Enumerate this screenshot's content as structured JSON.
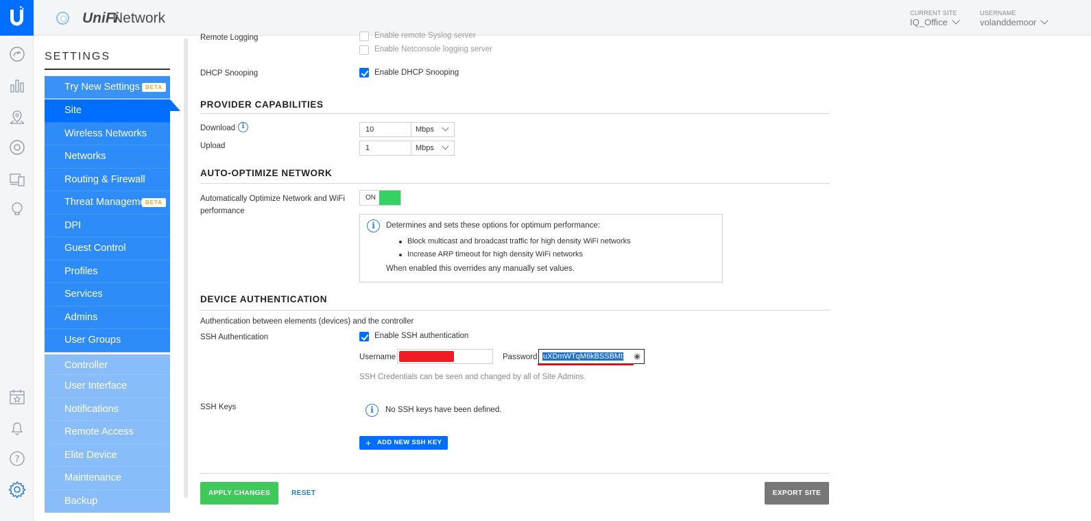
{
  "app": {
    "brand_unifi": "UniFi",
    "brand_network": "Network"
  },
  "topbar": {
    "site_label": "CURRENT SITE",
    "site_value": "IQ_Office",
    "user_label": "USERNAME",
    "user_value": "volanddemoor"
  },
  "leftnav": {
    "icons": [
      "dashboard-icon",
      "statistics-icon",
      "map-icon",
      "devices-icon",
      "clients-icon",
      "insights-icon",
      "events-icon",
      "alerts-icon",
      "help-icon",
      "settings-icon"
    ],
    "active_color": "#006fff"
  },
  "sidebar": {
    "title": "SETTINGS",
    "items": [
      {
        "label": "Try New Settings",
        "badge": "BETA"
      },
      {
        "label": "Site"
      },
      {
        "label": "Wireless Networks"
      },
      {
        "label": "Networks"
      },
      {
        "label": "Routing & Firewall"
      },
      {
        "label": "Threat Management",
        "badge": "BETA"
      },
      {
        "label": "DPI"
      },
      {
        "label": "Guest Control"
      },
      {
        "label": "Profiles"
      },
      {
        "label": "Services"
      },
      {
        "label": "Admins"
      },
      {
        "label": "User Groups"
      },
      {
        "label": "Controller"
      },
      {
        "label": "User Interface"
      },
      {
        "label": "Notifications"
      },
      {
        "label": "Remote Access"
      },
      {
        "label": "Elite Device"
      },
      {
        "label": "Maintenance"
      },
      {
        "label": "Backup"
      }
    ]
  },
  "remote_logging": {
    "label": "Remote Logging",
    "opt1": "Enable remote Syslog server",
    "opt2": "Enable Netconsole logging server"
  },
  "dhcp": {
    "label": "DHCP Snooping",
    "opt": "Enable DHCP Snooping",
    "checked": true
  },
  "provider": {
    "heading": "PROVIDER CAPABILITIES",
    "download_label": "Download",
    "download_value": "10",
    "download_unit": "Mbps",
    "upload_label": "Upload",
    "upload_value": "1",
    "upload_unit": "Mbps"
  },
  "auto_optimize": {
    "heading": "AUTO-OPTIMIZE NETWORK",
    "label": "Automatically Optimize Network and WiFi performance",
    "toggle": "ON",
    "info_intro": "Determines and sets these options for optimum performance:",
    "bullet1": "Block multicast and broadcast traffic for high density WiFi networks",
    "bullet2": "Increase ARP timeout for high density WiFi networks",
    "info_outro": "When enabled this overrides any manually set values."
  },
  "device_auth": {
    "heading": "DEVICE AUTHENTICATION",
    "desc": "Authentication between elements (devices) and the controller",
    "ssh_label": "SSH Authentication",
    "ssh_opt": "Enable SSH authentication",
    "username_label": "Username",
    "password_label": "Password",
    "password_value": "uXDmWTqM6kBSSBMt",
    "creds_note": "SSH Credentials can be seen and changed by all of Site Admins.",
    "keys_label": "SSH Keys",
    "keys_empty": "No SSH keys have been defined.",
    "add_key": "ADD NEW SSH KEY"
  },
  "footer": {
    "apply": "APPLY CHANGES",
    "reset": "RESET",
    "export": "EXPORT SITE"
  }
}
